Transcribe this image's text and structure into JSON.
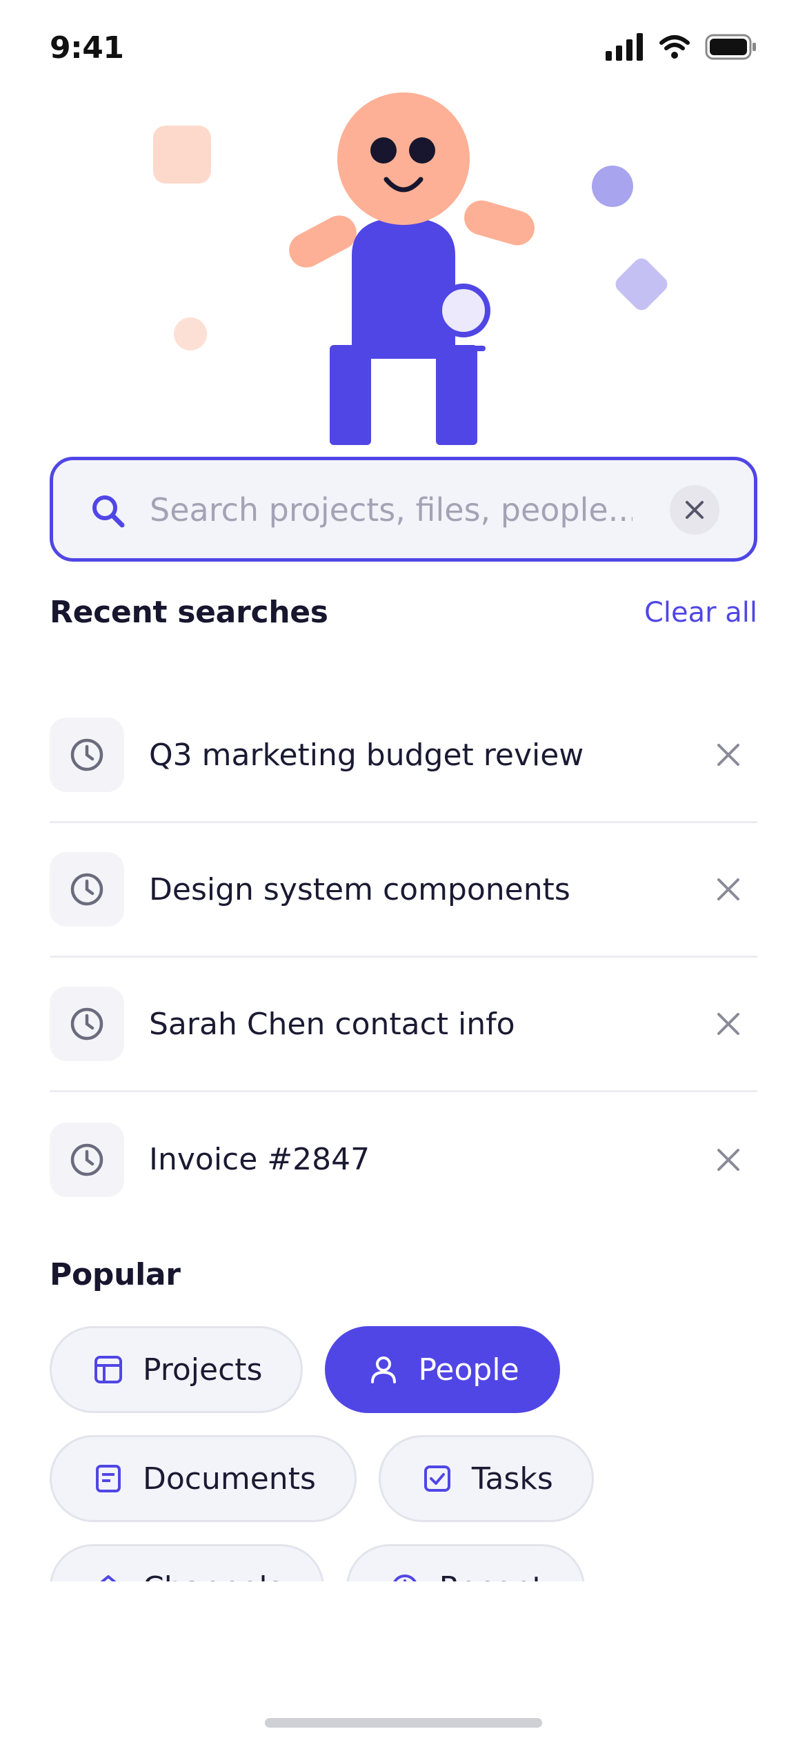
{
  "status_bar": {
    "time": "9:41"
  },
  "search": {
    "placeholder": "Search projects, files, people...",
    "value": ""
  },
  "recent": {
    "title": "Recent searches",
    "clear_all": "Clear all",
    "items": [
      {
        "label": "Q3 marketing budget review"
      },
      {
        "label": "Design system components"
      },
      {
        "label": "Sarah Chen contact info"
      },
      {
        "label": "Invoice #2847"
      }
    ]
  },
  "popular": {
    "title": "Popular",
    "chips": [
      {
        "label": "Projects",
        "icon": "layout-icon",
        "active": false
      },
      {
        "label": "People",
        "icon": "user-icon",
        "active": true
      },
      {
        "label": "Documents",
        "icon": "document-icon",
        "active": false
      },
      {
        "label": "Tasks",
        "icon": "checkbox-icon",
        "active": false
      },
      {
        "label": "Channels",
        "icon": "home-icon",
        "active": false
      },
      {
        "label": "Recent",
        "icon": "clock-icon",
        "active": false
      }
    ]
  },
  "colors": {
    "accent": "#5046e5",
    "skin": "#fdb095",
    "text": "#1b1a33",
    "muted": "#a3a3b5"
  }
}
